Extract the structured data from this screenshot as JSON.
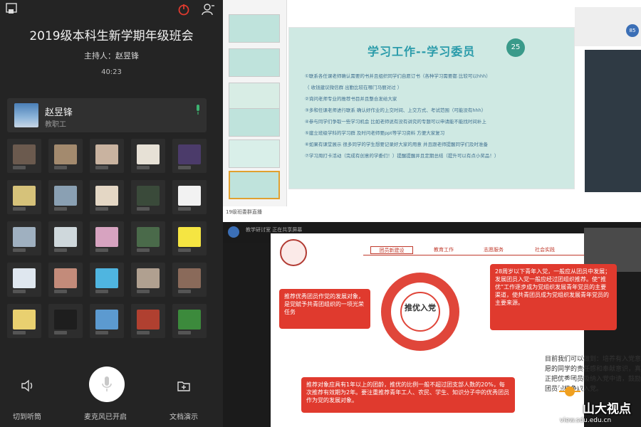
{
  "meeting": {
    "title": "2019级本科生新学期年级班会",
    "host": "主持人：赵昱锋",
    "elapsed": "40:23",
    "speaker": {
      "name": "赵昱锋",
      "role": "教职工"
    },
    "controls": {
      "speaker_mode": "切到听筒",
      "mic": "麦克风已开启",
      "doc_share": "文档演示"
    }
  },
  "slides_app": {
    "slide_title": "学习工作--学习委员",
    "badge": "25",
    "lines": [
      "①联系各任课老师确认需要的书并且组织同学们自愿订书（各种学习需要都 比较可以hhh）",
      "（ 收钱建议微信群 出勤比较在哪门马丽对过 ）",
      "②询问老师专业的推荐书目并且整合发给大家",
      "③多和任课老师进行联系 确认好作业的上交时间、上交方式、考试范围（可能没有hhh）",
      "④参与同学们争取一些学习机会 比如老师说有没有讲究的专题可以申请能不能找时间补上",
      "⑤建立班级学科的学习群 及时问老师要ppt等学习资料 方便大家复习",
      "⑥如果有课堂展示 很多同学的学生想要记录好大家的用意 并且跟老师提醒同学们及时准备",
      "⑦学习周打卡活动（完成有创意的学委们！）提醒提醒并且定期总结（提升可以有点小奖品！）"
    ],
    "caption": "19级班委群直播",
    "inner_avatar": "85"
  },
  "share": {
    "title": "教学研讨室 正在共享屏幕",
    "nav_tabs": [
      "团员新建设",
      "教育工作",
      "志愿服务",
      "社会实践"
    ],
    "ring_text": "推优入党",
    "left_box": "推荐优秀团员作党的发展对象，是党赋予共青团组织的一项光荣任务",
    "right_box": "28周岁以下青年入党，一般应从团员中发展；发展团员入党一般应经过团组织推荐。使“推优”工作逐步成为党组织发展青年党员的主要渠道，使共青团员成为党组织发展青年党员的主要来源。",
    "bottom_box": "推荐对象应具有1年以上的团龄，推优的比例一般不超过团支部人数的20%，每次推荐有效期为2年。要注重推荐青年工人、农民、学生、知识分子中的优秀团员作为党的发展对象。",
    "right_text": "目前我们可以做到：培养有入党意愿的同学的责任感和奉献意识，真正把优秀团员吸纳入党中请，鼓励团员积极争取入党。",
    "watermark": "山大视点",
    "watermark_url": "view.sdu.edu.cn"
  },
  "colors": {
    "accent_red": "#e03a2e",
    "slide_teal": "#2a9baa",
    "panel_dark": "#242424"
  }
}
